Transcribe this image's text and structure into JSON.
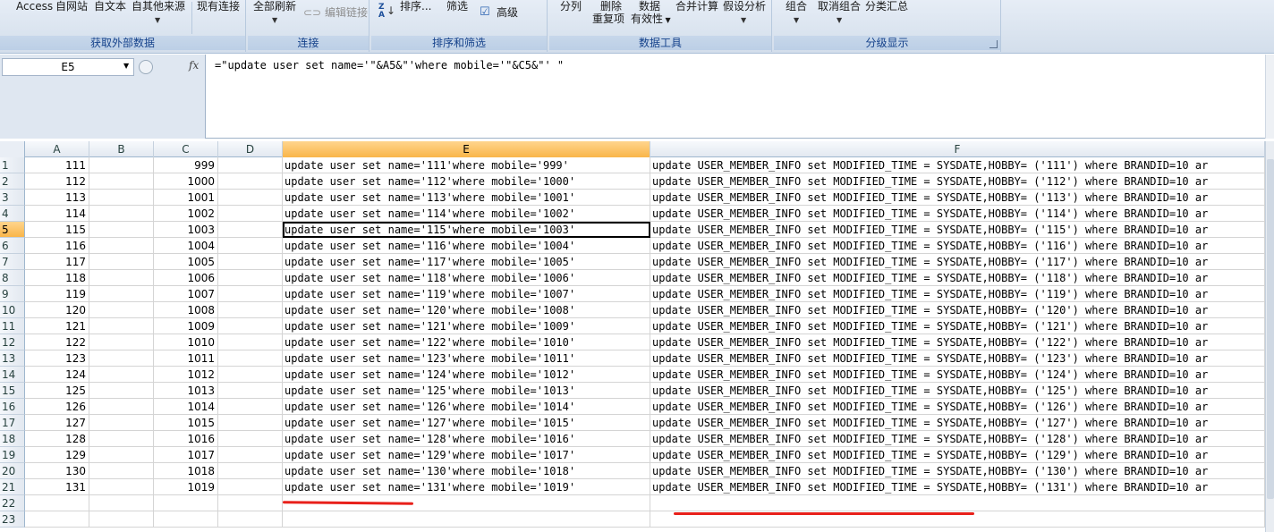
{
  "ribbon": {
    "groups": [
      {
        "label": "获取外部数据",
        "buttons": [
          "Access",
          "自网站",
          "自文本",
          "自其他来源",
          "现有连接"
        ]
      },
      {
        "label": "连接",
        "buttons": [
          "全部刷新",
          "编辑链接"
        ]
      },
      {
        "label": "排序和筛选",
        "buttons": [
          "排序...",
          "筛选",
          "高级"
        ]
      },
      {
        "label": "数据工具",
        "buttons": [
          "分列",
          "删除",
          "重复项",
          "数据",
          "有效性",
          "合并计算",
          "假设分析"
        ]
      },
      {
        "label": "分级显示",
        "buttons": [
          "组合",
          "取消组合",
          "分类汇总"
        ]
      }
    ]
  },
  "formula_bar": {
    "name_box": "E5",
    "fx_label": "fx",
    "formula": "=\"update user set name='\"&A5&\"'where mobile='\"&C5&\"' \""
  },
  "sheet": {
    "columns": [
      "A",
      "B",
      "C",
      "D",
      "E",
      "F"
    ],
    "active_column": "E",
    "active_row": 5,
    "rows": [
      {
        "n": "1",
        "a": "111",
        "c": "999",
        "e": "update user set name='111'where mobile='999'",
        "f": "update USER_MEMBER_INFO set MODIFIED_TIME = SYSDATE,HOBBY= ('111') where BRANDID=10 ar"
      },
      {
        "n": "2",
        "a": "112",
        "c": "1000",
        "e": "update user set name='112'where mobile='1000'",
        "f": "update USER_MEMBER_INFO set MODIFIED_TIME = SYSDATE,HOBBY= ('112') where BRANDID=10 ar"
      },
      {
        "n": "3",
        "a": "113",
        "c": "1001",
        "e": "update user set name='113'where mobile='1001'",
        "f": "update USER_MEMBER_INFO set MODIFIED_TIME = SYSDATE,HOBBY= ('113') where BRANDID=10 ar"
      },
      {
        "n": "4",
        "a": "114",
        "c": "1002",
        "e": "update user set name='114'where mobile='1002'",
        "f": "update USER_MEMBER_INFO set MODIFIED_TIME = SYSDATE,HOBBY= ('114') where BRANDID=10 ar"
      },
      {
        "n": "5",
        "a": "115",
        "c": "1003",
        "e": "update user set name='115'where mobile='1003'",
        "f": "update USER_MEMBER_INFO set MODIFIED_TIME = SYSDATE,HOBBY= ('115') where BRANDID=10 ar"
      },
      {
        "n": "6",
        "a": "116",
        "c": "1004",
        "e": "update user set name='116'where mobile='1004'",
        "f": "update USER_MEMBER_INFO set MODIFIED_TIME = SYSDATE,HOBBY= ('116') where BRANDID=10 ar"
      },
      {
        "n": "7",
        "a": "117",
        "c": "1005",
        "e": "update user set name='117'where mobile='1005'",
        "f": "update USER_MEMBER_INFO set MODIFIED_TIME = SYSDATE,HOBBY= ('117') where BRANDID=10 ar"
      },
      {
        "n": "8",
        "a": "118",
        "c": "1006",
        "e": "update user set name='118'where mobile='1006'",
        "f": "update USER_MEMBER_INFO set MODIFIED_TIME = SYSDATE,HOBBY= ('118') where BRANDID=10 ar"
      },
      {
        "n": "9",
        "a": "119",
        "c": "1007",
        "e": "update user set name='119'where mobile='1007'",
        "f": "update USER_MEMBER_INFO set MODIFIED_TIME = SYSDATE,HOBBY= ('119') where BRANDID=10 ar"
      },
      {
        "n": "10",
        "a": "120",
        "c": "1008",
        "e": "update user set name='120'where mobile='1008'",
        "f": "update USER_MEMBER_INFO set MODIFIED_TIME = SYSDATE,HOBBY= ('120') where BRANDID=10 ar"
      },
      {
        "n": "11",
        "a": "121",
        "c": "1009",
        "e": "update user set name='121'where mobile='1009'",
        "f": "update USER_MEMBER_INFO set MODIFIED_TIME = SYSDATE,HOBBY= ('121') where BRANDID=10 ar"
      },
      {
        "n": "12",
        "a": "122",
        "c": "1010",
        "e": "update user set name='122'where mobile='1010'",
        "f": "update USER_MEMBER_INFO set MODIFIED_TIME = SYSDATE,HOBBY= ('122') where BRANDID=10 ar"
      },
      {
        "n": "13",
        "a": "123",
        "c": "1011",
        "e": "update user set name='123'where mobile='1011'",
        "f": "update USER_MEMBER_INFO set MODIFIED_TIME = SYSDATE,HOBBY= ('123') where BRANDID=10 ar"
      },
      {
        "n": "14",
        "a": "124",
        "c": "1012",
        "e": "update user set name='124'where mobile='1012'",
        "f": "update USER_MEMBER_INFO set MODIFIED_TIME = SYSDATE,HOBBY= ('124') where BRANDID=10 ar"
      },
      {
        "n": "15",
        "a": "125",
        "c": "1013",
        "e": "update user set name='125'where mobile='1013'",
        "f": "update USER_MEMBER_INFO set MODIFIED_TIME = SYSDATE,HOBBY= ('125') where BRANDID=10 ar"
      },
      {
        "n": "16",
        "a": "126",
        "c": "1014",
        "e": "update user set name='126'where mobile='1014'",
        "f": "update USER_MEMBER_INFO set MODIFIED_TIME = SYSDATE,HOBBY= ('126') where BRANDID=10 ar"
      },
      {
        "n": "17",
        "a": "127",
        "c": "1015",
        "e": "update user set name='127'where mobile='1015'",
        "f": "update USER_MEMBER_INFO set MODIFIED_TIME = SYSDATE,HOBBY= ('127') where BRANDID=10 ar"
      },
      {
        "n": "18",
        "a": "128",
        "c": "1016",
        "e": "update user set name='128'where mobile='1016'",
        "f": "update USER_MEMBER_INFO set MODIFIED_TIME = SYSDATE,HOBBY= ('128') where BRANDID=10 ar"
      },
      {
        "n": "19",
        "a": "129",
        "c": "1017",
        "e": "update user set name='129'where mobile='1017'",
        "f": "update USER_MEMBER_INFO set MODIFIED_TIME = SYSDATE,HOBBY= ('129') where BRANDID=10 ar"
      },
      {
        "n": "20",
        "a": "130",
        "c": "1018",
        "e": "update user set name='130'where mobile='1018'",
        "f": "update USER_MEMBER_INFO set MODIFIED_TIME = SYSDATE,HOBBY= ('130') where BRANDID=10 ar"
      },
      {
        "n": "21",
        "a": "131",
        "c": "1019",
        "e": "update user set name='131'where mobile='1019'",
        "f": "update USER_MEMBER_INFO set MODIFIED_TIME = SYSDATE,HOBBY= ('131') where BRANDID=10 ar"
      },
      {
        "n": "22",
        "a": "",
        "c": "",
        "e": "",
        "f": ""
      },
      {
        "n": "23",
        "a": "",
        "c": "",
        "e": "",
        "f": ""
      }
    ]
  },
  "colors": {
    "annotation_red": "#e8201a",
    "active_header": "#f9b549"
  }
}
